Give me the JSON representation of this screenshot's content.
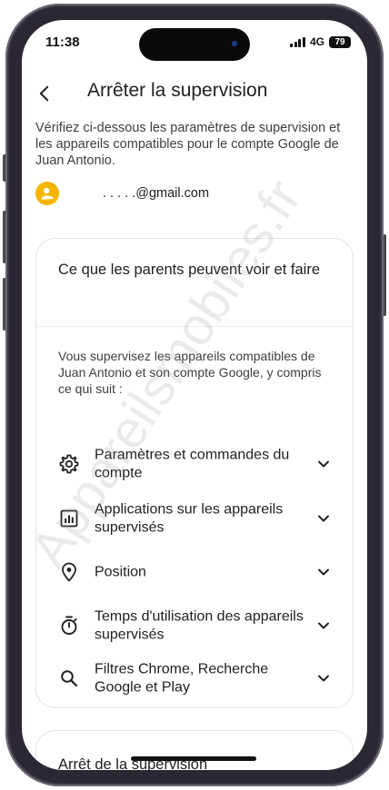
{
  "status_bar": {
    "time": "11:38",
    "network": "4G",
    "battery": "79"
  },
  "header": {
    "title": "Arrêter la supervision",
    "back_icon": "back-arrow-icon"
  },
  "intro": {
    "text": "Vérifiez ci-dessous les paramètres de supervision et les appareils compatibles pour le compte Google de Juan Antonio."
  },
  "account": {
    "email": ". . . . .@gmail.com",
    "avatar_color": "#f5b400"
  },
  "card": {
    "title": "Ce que les parents peuvent voir et faire",
    "description": "Vous supervisez les appareils compatibles de Juan Antonio et son compte Google, y compris ce qui suit :",
    "items": [
      {
        "label": "Paramètres et commandes du compte",
        "icon": "gear-icon"
      },
      {
        "label": "Applications sur les appareils supervisés",
        "icon": "app-activity-icon"
      },
      {
        "label": "Position",
        "icon": "location-pin-icon"
      },
      {
        "label": "Temps d'utilisation des appareils supervisés",
        "icon": "timer-icon"
      },
      {
        "label": "Filtres Chrome, Recherche Google et Play",
        "icon": "search-icon"
      }
    ]
  },
  "stop_section": {
    "title": "Arrêt de la supervision"
  },
  "watermark": "Appareilsmobiles.fr",
  "colors": {
    "frame": "#2b2733",
    "text_primary": "#202124",
    "text_secondary": "#3c4043",
    "card_border": "#e3e3e6"
  }
}
